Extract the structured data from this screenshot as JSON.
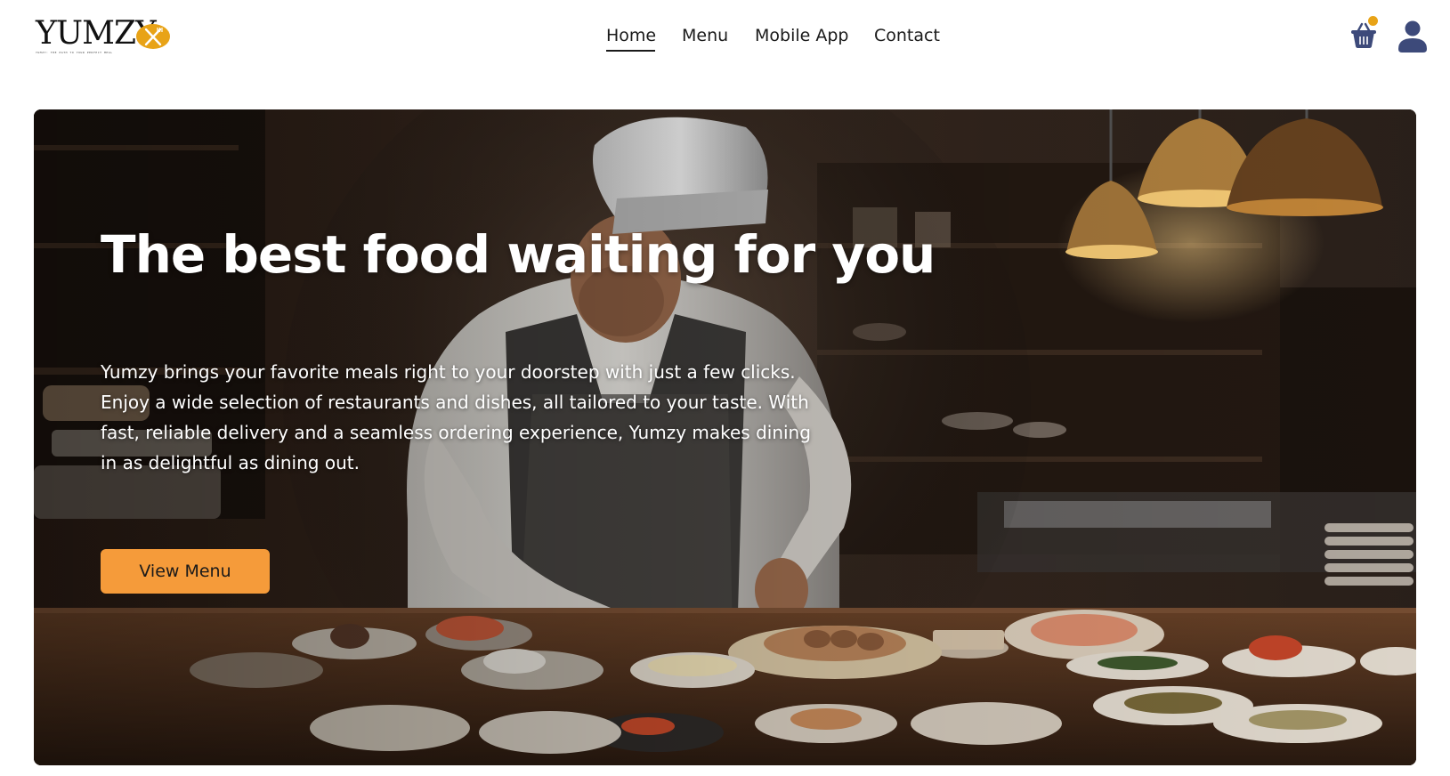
{
  "brand": {
    "name": "YUMZY",
    "tagline": "YUMZY: THE PATH TO YOUR PERFECT MEAL",
    "accent": "#e8a317"
  },
  "nav": {
    "items": [
      {
        "label": "Home",
        "active": true
      },
      {
        "label": "Menu",
        "active": false
      },
      {
        "label": "Mobile App",
        "active": false
      },
      {
        "label": "Contact",
        "active": false
      }
    ]
  },
  "header_actions": {
    "cart_icon": "basket-icon",
    "cart_has_items": true,
    "profile_icon": "user-icon",
    "icon_color": "#3d4a7a"
  },
  "hero": {
    "title": "The best food waiting for you",
    "description": "Yumzy brings your favorite meals right to your doorstep with just a few clicks. Enjoy a wide selection of restaurants and dishes, all tailored to your taste. With fast, reliable delivery and a seamless ordering experience, Yumzy makes dining in as delightful as dining out.",
    "cta_label": "View Menu",
    "cta_color": "#f59b3a",
    "image": "chef-plating-sushi-photo"
  }
}
